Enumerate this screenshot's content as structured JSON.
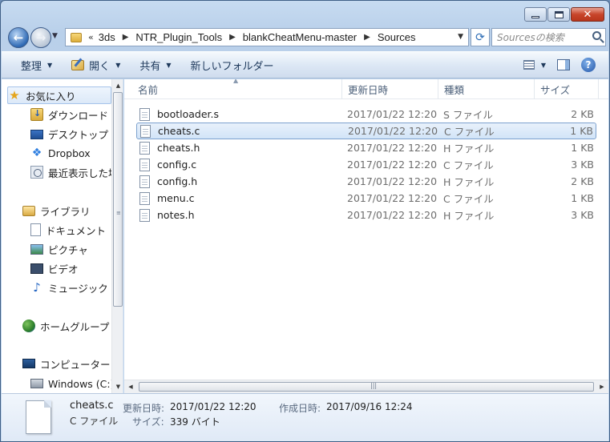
{
  "address": {
    "overflow": "«",
    "crumbs": [
      "3ds",
      "NTR_Plugin_Tools",
      "blankCheatMenu-master",
      "Sources"
    ]
  },
  "search": {
    "placeholder": "Sourcesの検索"
  },
  "toolbar": {
    "organize": "整理",
    "open": "開く",
    "share": "共有",
    "new_folder": "新しいフォルダー"
  },
  "nav": {
    "favorites": "お気に入り",
    "downloads": "ダウンロード",
    "desktop": "デスクトップ",
    "dropbox": "Dropbox",
    "recent": "最近表示した場所",
    "libraries": "ライブラリ",
    "documents": "ドキュメント",
    "pictures": "ピクチャ",
    "videos": "ビデオ",
    "music": "ミュージック",
    "homegroup": "ホームグループ",
    "computer": "コンピューター",
    "drive_c": "Windows (C:)"
  },
  "columns": {
    "name": "名前",
    "date": "更新日時",
    "type": "種類",
    "size": "サイズ"
  },
  "files": [
    {
      "name": "bootloader.s",
      "date": "2017/01/22 12:20",
      "type": "S ファイル",
      "size": "2 KB"
    },
    {
      "name": "cheats.c",
      "date": "2017/01/22 12:20",
      "type": "C ファイル",
      "size": "1 KB"
    },
    {
      "name": "cheats.h",
      "date": "2017/01/22 12:20",
      "type": "H ファイル",
      "size": "1 KB"
    },
    {
      "name": "config.c",
      "date": "2017/01/22 12:20",
      "type": "C ファイル",
      "size": "3 KB"
    },
    {
      "name": "config.h",
      "date": "2017/01/22 12:20",
      "type": "H ファイル",
      "size": "2 KB"
    },
    {
      "name": "menu.c",
      "date": "2017/01/22 12:20",
      "type": "C ファイル",
      "size": "1 KB"
    },
    {
      "name": "notes.h",
      "date": "2017/01/22 12:20",
      "type": "H ファイル",
      "size": "3 KB"
    }
  ],
  "details": {
    "name": "cheats.c",
    "type": "C ファイル",
    "modified_label": "更新日時:",
    "modified": "2017/01/22 12:20",
    "created_label": "作成日時:",
    "created": "2017/09/16 12:24",
    "size_label": "サイズ:",
    "size": "339 バイト"
  }
}
